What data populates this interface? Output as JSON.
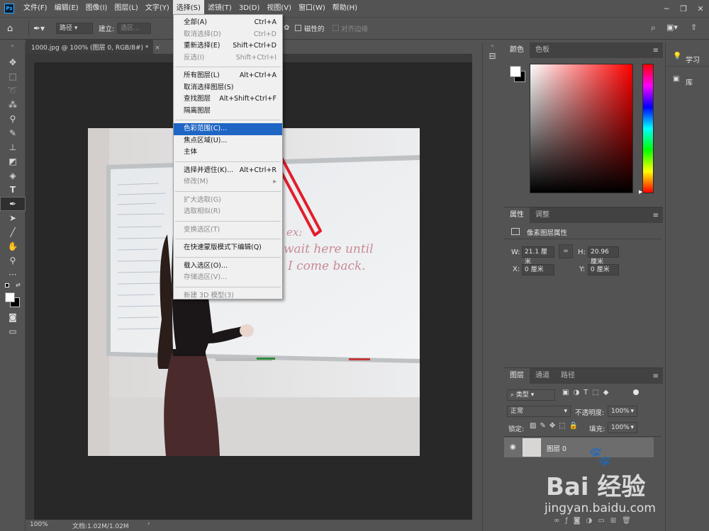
{
  "menubar": {
    "logo": "Ps",
    "items": [
      "文件(F)",
      "编辑(E)",
      "图像(I)",
      "图层(L)",
      "文字(Y)",
      "选择(S)",
      "滤镜(T)",
      "3D(D)",
      "视图(V)",
      "窗口(W)",
      "帮助(H)"
    ],
    "active_index": 5
  },
  "options": {
    "mode": "路径",
    "make_label": "建立:",
    "make_value": "选区...",
    "edge_label": "磁性的",
    "align_label": "对齐边缘"
  },
  "document": {
    "tab_title": "1000.jpg @ 100% (图层 0, RGB/8#) *",
    "close": "×"
  },
  "status": {
    "zoom": "100%",
    "doc_info": "文档:1.02M/1.02M"
  },
  "whiteboard_text": {
    "line1": "ex:",
    "line2": "wait here until",
    "line3": "I come back."
  },
  "select_menu": {
    "groups": [
      [
        {
          "label": "全部(A)",
          "shortcut": "Ctrl+A",
          "disabled": false
        },
        {
          "label": "取消选择(D)",
          "shortcut": "Ctrl+D",
          "disabled": true
        },
        {
          "label": "重新选择(E)",
          "shortcut": "Shift+Ctrl+D",
          "disabled": false
        },
        {
          "label": "反选(I)",
          "shortcut": "Shift+Ctrl+I",
          "disabled": true
        }
      ],
      [
        {
          "label": "所有图层(L)",
          "shortcut": "Alt+Ctrl+A",
          "disabled": false
        },
        {
          "label": "取消选择图层(S)",
          "shortcut": "",
          "disabled": false
        },
        {
          "label": "查找图层",
          "shortcut": "Alt+Shift+Ctrl+F",
          "disabled": false
        },
        {
          "label": "隔离图层",
          "shortcut": "",
          "disabled": false
        }
      ],
      [
        {
          "label": "色彩范围(C)...",
          "shortcut": "",
          "disabled": false,
          "highlight": true
        },
        {
          "label": "焦点区域(U)...",
          "shortcut": "",
          "disabled": false
        },
        {
          "label": "主体",
          "shortcut": "",
          "disabled": false
        }
      ],
      [
        {
          "label": "选择并遮住(K)...",
          "shortcut": "Alt+Ctrl+R",
          "disabled": false
        },
        {
          "label": "修改(M)",
          "shortcut": "▸",
          "disabled": true
        }
      ],
      [
        {
          "label": "扩大选取(G)",
          "shortcut": "",
          "disabled": true
        },
        {
          "label": "选取相似(R)",
          "shortcut": "",
          "disabled": true
        }
      ],
      [
        {
          "label": "变换选区(T)",
          "shortcut": "",
          "disabled": true
        }
      ],
      [
        {
          "label": "在快速蒙版模式下编辑(Q)",
          "shortcut": "",
          "disabled": false
        }
      ],
      [
        {
          "label": "载入选区(O)...",
          "shortcut": "",
          "disabled": false
        },
        {
          "label": "存储选区(V)...",
          "shortcut": "",
          "disabled": true
        }
      ],
      [
        {
          "label": "新建 3D 模型(3)",
          "shortcut": "",
          "disabled": true
        }
      ]
    ]
  },
  "color_panel": {
    "tabs": [
      "颜色",
      "色板"
    ],
    "active": 0,
    "colors": {
      "foreground": "#ffffff",
      "background": "#000000",
      "hue": "#ff0000"
    }
  },
  "properties_panel": {
    "tabs": [
      "属性",
      "调整"
    ],
    "active": 0,
    "title": "像素图层属性",
    "w_label": "W:",
    "w_value": "21.1 厘米",
    "h_label": "H:",
    "h_value": "20.96 厘米",
    "x_label": "X:",
    "x_value": "0 厘米",
    "y_label": "Y:",
    "y_value": "0 厘米"
  },
  "layers_panel": {
    "tabs": [
      "图层",
      "通道",
      "路径"
    ],
    "active": 0,
    "filter": "类型",
    "blend_mode": "正常",
    "opacity_label": "不透明度:",
    "opacity": "100%",
    "lock_label": "锁定:",
    "fill_label": "填充:",
    "fill": "100%",
    "layers": [
      {
        "name": "图层 0",
        "visible": true
      }
    ]
  },
  "learn_panel": {
    "items": [
      "学习",
      "库"
    ]
  },
  "watermark": {
    "brand": "Bai 经验",
    "url": "jingyan.baidu.com"
  }
}
